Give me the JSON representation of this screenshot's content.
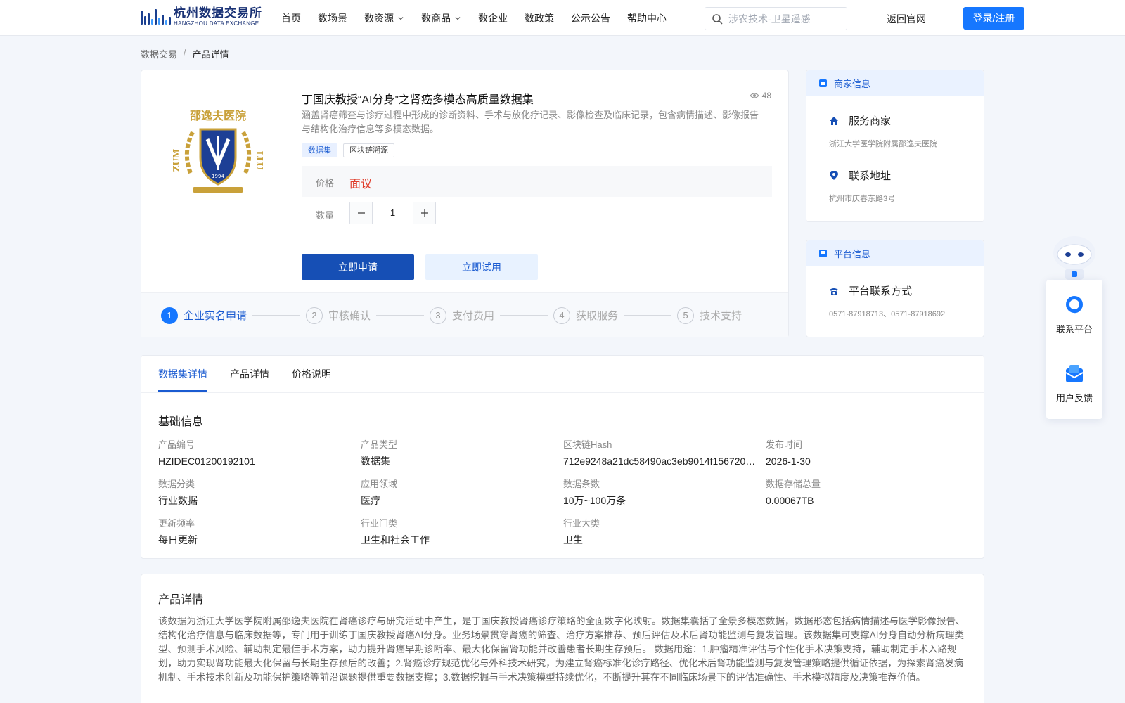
{
  "header": {
    "logo_cn": "杭州数据交易所",
    "logo_en": "HANGZHOU DATA EXCHANGE",
    "nav": [
      {
        "label": "首页",
        "dropdown": false
      },
      {
        "label": "数场景",
        "dropdown": false
      },
      {
        "label": "数资源",
        "dropdown": true
      },
      {
        "label": "数商品",
        "dropdown": true
      },
      {
        "label": "数企业",
        "dropdown": false
      },
      {
        "label": "数政策",
        "dropdown": false
      },
      {
        "label": "公示公告",
        "dropdown": false
      },
      {
        "label": "帮助中心",
        "dropdown": false
      }
    ],
    "search_placeholder": "涉农技术-卫星遥感",
    "back_link": "返回官网",
    "login_label": "登录/注册"
  },
  "breadcrumb": {
    "root": "数据交易",
    "separator": "/",
    "current": "产品详情"
  },
  "product": {
    "title": "丁国庆教授“AI分身”之肾癌多模态高质量数据集",
    "views": "48",
    "description": "涵盖肾癌筛查与诊疗过程中形成的诊断资料、手术与放化疗记录、影像检查及临床记录，包含病情描述、影像报告与结构化治疗信息等多模态数据。",
    "tags": [
      "数据集",
      "区块链溯源"
    ],
    "price_label": "价格",
    "price_value": "面议",
    "qty_label": "数量",
    "qty_value": "1",
    "apply_label": "立即申请",
    "trial_label": "立即试用",
    "logo_text_top": "邵逸夫医院",
    "logo_text_left": "ZUM",
    "logo_text_right": "LLU",
    "logo_year": "1994"
  },
  "steps": [
    {
      "num": "1",
      "label": "企业实名申请",
      "active": true
    },
    {
      "num": "2",
      "label": "审核确认",
      "active": false
    },
    {
      "num": "3",
      "label": "支付费用",
      "active": false
    },
    {
      "num": "4",
      "label": "获取服务",
      "active": false
    },
    {
      "num": "5",
      "label": "技术支持",
      "active": false
    }
  ],
  "merchant": {
    "head": "商家信息",
    "service_label": "服务商家",
    "service_value": "浙江大学医学院附属邵逸夫医院",
    "address_label": "联系地址",
    "address_value": "杭州市庆春东路3号"
  },
  "platform": {
    "head": "平台信息",
    "contact_label": "平台联系方式",
    "contact_value": "0571-87918713、0571-87918692"
  },
  "float": {
    "contact": "联系平台",
    "feedback": "用户反馈"
  },
  "tabs": [
    {
      "label": "数据集详情",
      "active": true
    },
    {
      "label": "产品详情",
      "active": false
    },
    {
      "label": "价格说明",
      "active": false
    }
  ],
  "basic": {
    "title": "基础信息",
    "fields": [
      {
        "k": "产品编号",
        "v": "HZIDEC01200192101"
      },
      {
        "k": "产品类型",
        "v": "数据集"
      },
      {
        "k": "区块链Hash",
        "v": "712e9248a21dc58490ac3eb9014f156720…"
      },
      {
        "k": "发布时间",
        "v": "2026-1-30"
      },
      {
        "k": "数据分类",
        "v": "行业数据"
      },
      {
        "k": "应用领域",
        "v": "医疗"
      },
      {
        "k": "数据条数",
        "v": "10万~100万条"
      },
      {
        "k": "数据存储总量",
        "v": "0.00067TB"
      },
      {
        "k": "更新频率",
        "v": "每日更新"
      },
      {
        "k": "行业门类",
        "v": "卫生和社会工作"
      },
      {
        "k": "行业大类",
        "v": "卫生"
      }
    ]
  },
  "product_detail": {
    "title": "产品详情",
    "text": "该数据为浙江大学医学院附属邵逸夫医院在肾癌诊疗与研究活动中产生，是丁国庆教授肾癌诊疗策略的全面数字化映射。数据集囊括了全景多模态数据，数据形态包括病情描述与医学影像报告、结构化治疗信息与临床数据等，专门用于训练丁国庆教授肾癌AI分身。业务场景贯穿肾癌的筛查、治疗方案推荐、预后评估及术后肾功能监测与复发管理。该数据集可支撑AI分身自动分析病理类型、预测手术风险、辅助制定最佳手术方案，助力提升肾癌早期诊断率、最大化保留肾功能并改善患者长期生存预后。 数据用途：1.肿瘤精准评估与个性化手术决策支持，辅助制定手术入路规划，助力实现肾功能最大化保留与长期生存预后的改善；2.肾癌诊疗规范优化与外科技术研究，为建立肾癌标准化诊疗路径、优化术后肾功能监测与复发管理策略提供循证依据，为探索肾癌发病机制、手术技术创新及功能保护策略等前沿课题提供重要数据支撑；3.数据挖掘与手术决策模型持续优化，不断提升其在不同临床场景下的评估准确性、手术模拟精度及决策推荐价值。"
  },
  "colors": {
    "primary": "#1677ff",
    "brand_dark": "#164fb5",
    "price": "#e03d2b"
  }
}
